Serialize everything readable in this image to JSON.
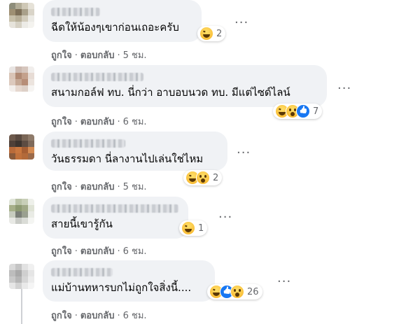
{
  "comments": [
    {
      "text": "ฉีดให้น้องๆเขาก่อนเถอะครับ",
      "reaction_count": "2",
      "reactions": [
        "haha"
      ],
      "like_label": "ถูกใจ",
      "reply_label": "ตอบกลับ",
      "time": "5 ชม."
    },
    {
      "text": "สนามกอล์ฟ ทบ. นี่กว่า อาบอบนวด ทบ. มีแต่ไซด์ไลน์",
      "reaction_count": "7",
      "reactions": [
        "haha",
        "wow",
        "like"
      ],
      "like_label": "ถูกใจ",
      "reply_label": "ตอบกลับ",
      "time": "6 ชม."
    },
    {
      "text": "วันธรรมดา นี่ลางานไปเล่นใช่ไหม",
      "reaction_count": "2",
      "reactions": [
        "haha",
        "wow"
      ],
      "like_label": "ถูกใจ",
      "reply_label": "ตอบกลับ",
      "time": "5 ชม."
    },
    {
      "text": "สายนี้เขารู้กัน",
      "reaction_count": "1",
      "reactions": [
        "haha"
      ],
      "like_label": "ถูกใจ",
      "reply_label": "ตอบกลับ",
      "time": "6 ชม."
    },
    {
      "text": "แม่บ้านทหารบกไม่ถูกใจสิ่งนี้....",
      "reaction_count": "26",
      "reactions": [
        "haha",
        "like",
        "wow"
      ],
      "like_label": "ถูกใจ",
      "reply_label": "ตอบกลับ",
      "time": "6 ชม."
    }
  ],
  "separator": "·",
  "more_icon": "more-horizontal-icon",
  "colors": {
    "bubble": "#f0f2f5",
    "secondary_text": "#65676b",
    "like_blue": "#1877f2",
    "emoji_yellow": "#f7b125"
  }
}
